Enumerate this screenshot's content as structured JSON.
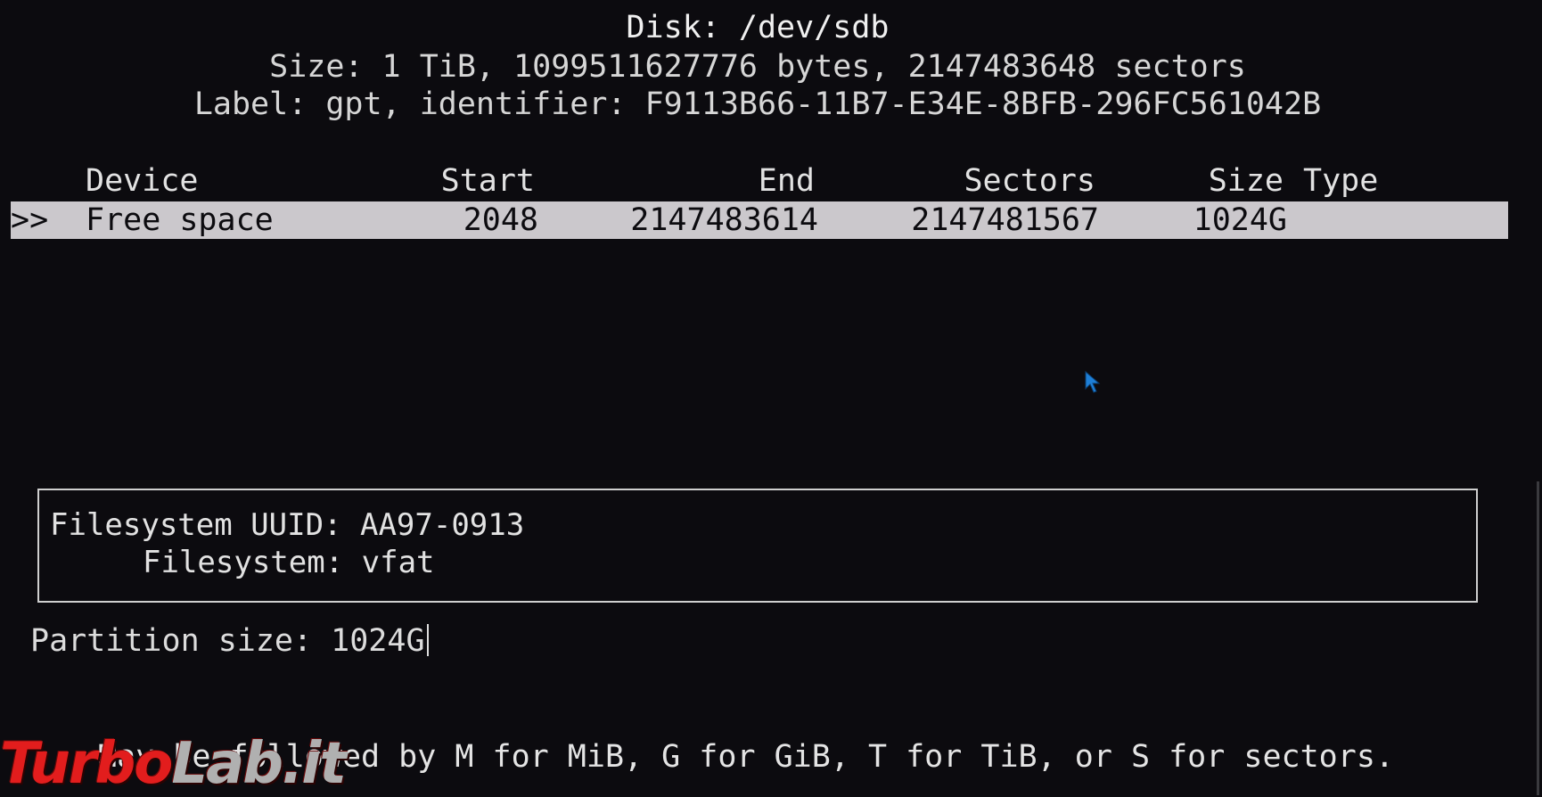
{
  "header": {
    "title": "Disk: /dev/sdb",
    "size_line": "Size: 1 TiB, 1099511627776 bytes, 2147483648 sectors",
    "label_line": "Label: gpt, identifier: F9113B66-11B7-E34E-8BFB-296FC561042B"
  },
  "table": {
    "columns": {
      "device": "Device",
      "start": "Start",
      "end": "End",
      "sectors": "Sectors",
      "size": "Size",
      "type": "Type"
    },
    "rows": [
      {
        "pointer": ">>",
        "device": "Free space",
        "start": "2048",
        "end": "2147483614",
        "sectors": "2147481567",
        "size": "1024G",
        "type": ""
      }
    ]
  },
  "info_box": {
    "line1": "Filesystem UUID: AA97-0913",
    "line2": "Filesystem: vfat"
  },
  "prompt": {
    "label": "Partition size: ",
    "value": "1024G"
  },
  "hint": {
    "text": "followed by M for MiB, G for GiB, T for TiB, or S for sectors.",
    "leading_partial": "May be "
  },
  "watermark": {
    "part1": "Turbo",
    "part2": "Lab.it"
  },
  "colors": {
    "background": "#0c0b0f",
    "selected_row": "#cbc8cc",
    "text": "#e2e2e2",
    "cursor": "#1e7fd6",
    "logo": "#e21d1d"
  }
}
